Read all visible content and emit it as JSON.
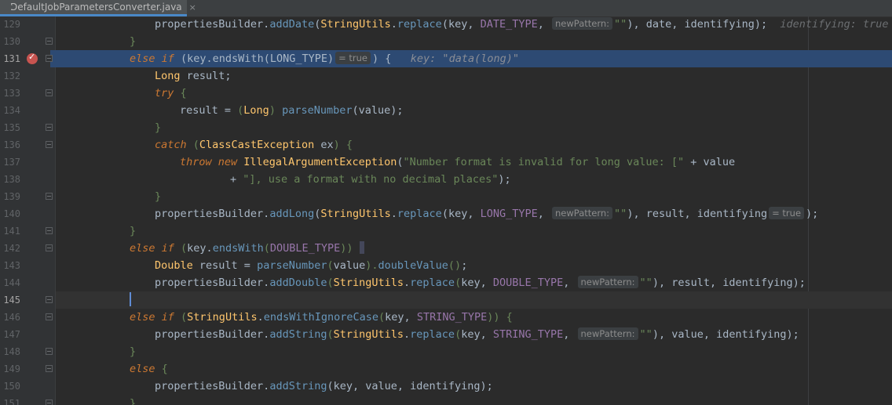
{
  "tab": {
    "file_name": "DefaultJobParametersConverter.java",
    "close": "×"
  },
  "lines": [
    {
      "num": "129"
    },
    {
      "num": "130"
    },
    {
      "num": "131"
    },
    {
      "num": "132"
    },
    {
      "num": "133"
    },
    {
      "num": "134"
    },
    {
      "num": "135"
    },
    {
      "num": "136"
    },
    {
      "num": "137"
    },
    {
      "num": "138"
    },
    {
      "num": "139"
    },
    {
      "num": "140"
    },
    {
      "num": "141"
    },
    {
      "num": "142"
    },
    {
      "num": "143"
    },
    {
      "num": "144"
    },
    {
      "num": "145"
    },
    {
      "num": "146"
    },
    {
      "num": "147"
    },
    {
      "num": "148"
    },
    {
      "num": "149"
    },
    {
      "num": "150"
    },
    {
      "num": "151"
    }
  ],
  "hints": {
    "new_pattern": "newPattern:",
    "eq_true": "= true"
  },
  "debug": {
    "line129": "identifying: true",
    "line131": "key: \"data(long)\""
  },
  "colors": {
    "execution_line": "#2d4a73",
    "breakpoint": "#c75450",
    "background": "#2b2b2b"
  }
}
